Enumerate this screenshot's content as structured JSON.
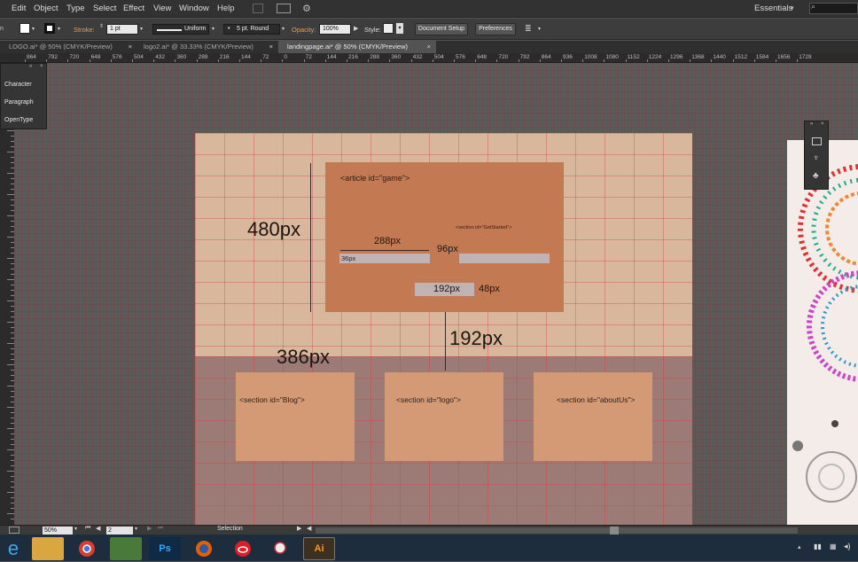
{
  "menubar": {
    "items": [
      "Edit",
      "Object",
      "Type",
      "Select",
      "Effect",
      "View",
      "Window",
      "Help"
    ],
    "workspace": "Essentials"
  },
  "controlbar": {
    "stroke_label": "Stroke:",
    "stroke_value": "1 pt",
    "profile_value": "Uniform",
    "brush_value": "5 pt. Round",
    "opacity_label": "Opacity:",
    "opacity_value": "100%",
    "style_label": "Style:",
    "document_setup": "Document Setup",
    "preferences": "Preferences"
  },
  "tabs": [
    {
      "label": "LOGO.ai* @ 50% (CMYK/Preview)",
      "active": false
    },
    {
      "label": "logo2.ai* @ 33.33% (CMYK/Preview)",
      "active": false
    },
    {
      "label": "landingpage.ai* @ 50% (CMYK/Preview)",
      "active": true
    }
  ],
  "tab_close": "×",
  "ruler_top": [
    "864",
    "792",
    "720",
    "648",
    "576",
    "504",
    "432",
    "360",
    "288",
    "216",
    "144",
    "72",
    "0",
    "72",
    "144",
    "216",
    "288",
    "360",
    "432",
    "504",
    "576",
    "648",
    "720",
    "792",
    "864",
    "936",
    "1008",
    "1080",
    "1152",
    "1224",
    "1296",
    "1368",
    "1440",
    "1512",
    "1584",
    "1656",
    "1728"
  ],
  "panel_left": {
    "items": [
      "Character",
      "Paragraph",
      "OpenType"
    ]
  },
  "canvas_labels": {
    "article": "<article id=\"game\">",
    "get_started": "<section id=\"GetStarted\">",
    "w288": "288px",
    "w96": "96px",
    "w36": "36px",
    "w192_box": "192px",
    "h48": "48px",
    "h480": "480px",
    "h192": "192px",
    "h386": "386px",
    "blog": "<section id=\"Blog\">",
    "logo": "<section id=\"logo\">",
    "about": "<section id=\"aboutUs\">"
  },
  "statusbar": {
    "zoom": "50%",
    "page": "2",
    "tool": "Selection"
  },
  "colors": {
    "artboard": "#d8b79c",
    "game_box": "#c37a52",
    "footer": "#9c7a76",
    "section": "#d39a75",
    "accent_orange": "#e8a045"
  }
}
